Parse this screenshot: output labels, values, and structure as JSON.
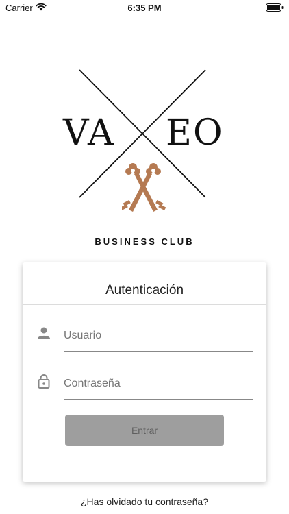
{
  "status_bar": {
    "carrier": "Carrier",
    "time": "6:35 PM",
    "wifi_icon": "wifi-icon",
    "battery_icon": "battery-icon"
  },
  "logo": {
    "left_text": "VA",
    "right_text": "EO",
    "tagline": "BUSINESS CLUB",
    "key_color": "#b57a52"
  },
  "login_card": {
    "title": "Autenticación",
    "username": {
      "placeholder": "Usuario",
      "value": "",
      "icon": "person-icon"
    },
    "password": {
      "placeholder": "Contraseña",
      "value": "",
      "icon": "lock-icon"
    },
    "submit_label": "Entrar"
  },
  "forgot_password_label": "¿Has olvidado tu contraseña?",
  "colors": {
    "button_bg": "#9e9e9e",
    "button_text": "#5f5f5f",
    "accent_keys": "#b57a52"
  }
}
